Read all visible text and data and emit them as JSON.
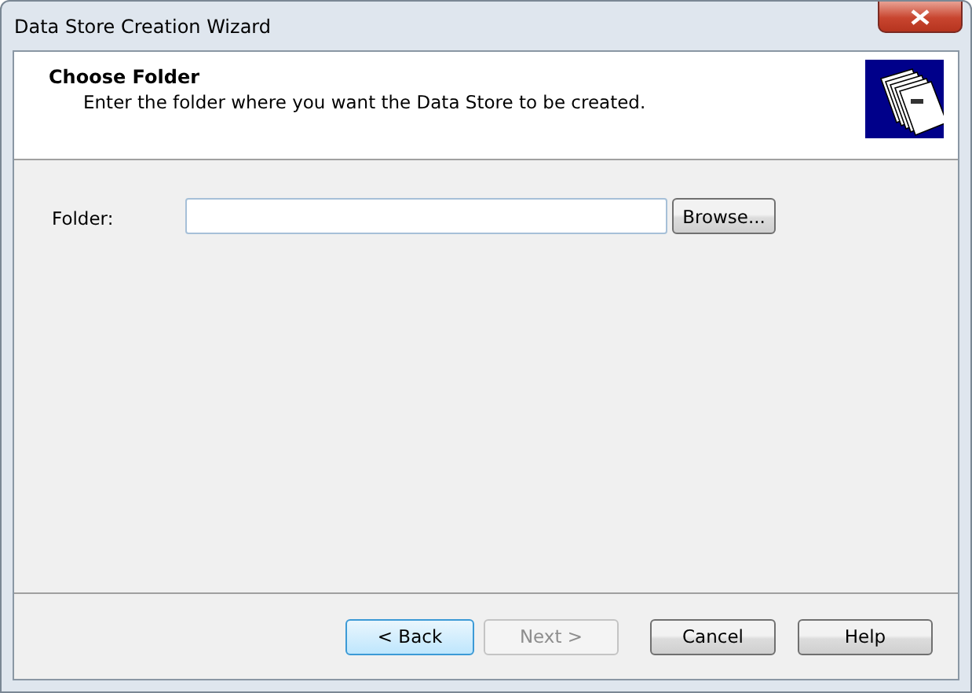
{
  "window": {
    "title": "Data Store Creation Wizard"
  },
  "header": {
    "title": "Choose Folder",
    "subtitle": "Enter the folder where you want the Data Store to be created."
  },
  "folder": {
    "label": "Folder:",
    "browse": "Browse..."
  },
  "buttons": [
    {
      "label": "< Back",
      "disabled": false,
      "focused": true
    },
    {
      "label": "Next >",
      "disabled": true,
      "focused": false
    },
    {
      "label": "Cancel",
      "disabled": false,
      "focused": false
    },
    {
      "label": "Help",
      "disabled": false,
      "focused": false
    }
  ]
}
